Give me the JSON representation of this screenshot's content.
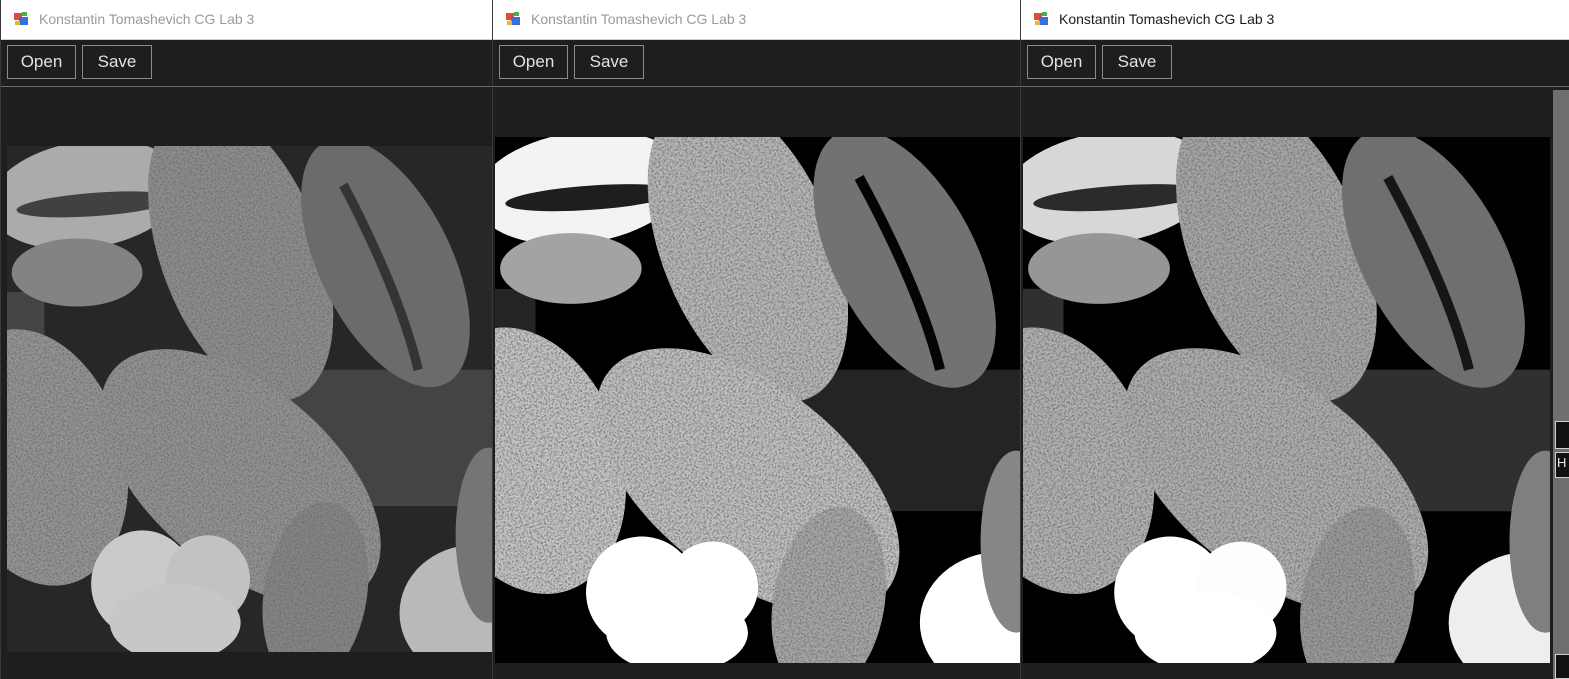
{
  "windows": [
    {
      "title": "Konstantin Tomashevich CG Lab 3",
      "active": false,
      "toolbar": {
        "open_label": "Open",
        "save_label": "Save"
      },
      "image_variant": "original"
    },
    {
      "title": "Konstantin Tomashevich CG Lab 3",
      "active": false,
      "toolbar": {
        "open_label": "Open",
        "save_label": "Save"
      },
      "image_variant": "contrast-enhanced"
    },
    {
      "title": "Konstantin Tomashevich CG Lab 3",
      "active": true,
      "toolbar": {
        "open_label": "Open",
        "save_label": "Save"
      },
      "image_variant": "posterized",
      "side_panel": {
        "partial_label": "H"
      }
    }
  ],
  "icons": {
    "app_icon": "app-window-icon"
  },
  "colors": {
    "window_bg": "#1e1e1e",
    "titlebar_bg": "#ffffff",
    "button_border": "#8b8b8b",
    "button_text": "#e2e2e2",
    "title_inactive": "#9a9a9a",
    "title_active": "#1a1a1a"
  }
}
